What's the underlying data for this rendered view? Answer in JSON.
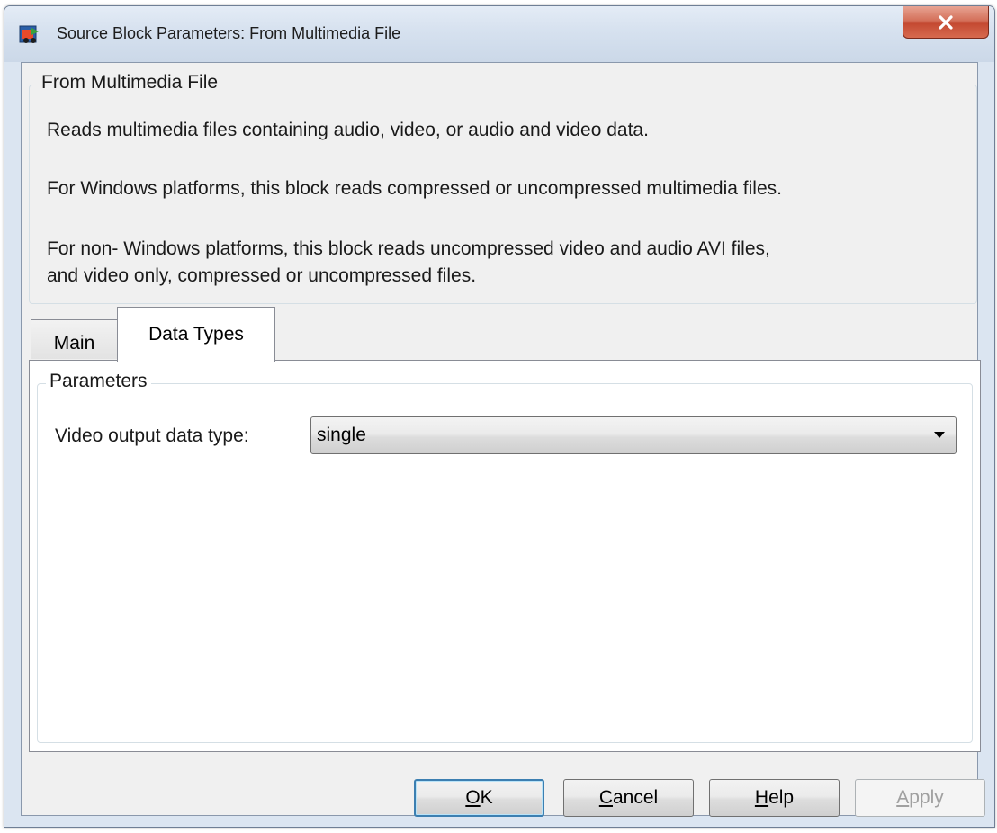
{
  "window": {
    "title": "Source Block Parameters: From Multimedia File",
    "close_label": "x"
  },
  "description": {
    "legend": "From Multimedia File",
    "lines": [
      "Reads multimedia files containing audio, video, or audio and video data.",
      "For Windows platforms, this block reads compressed or uncompressed multimedia files.",
      "For non- Windows platforms, this block reads uncompressed video and audio AVI files,",
      "and video only, compressed or uncompressed files."
    ]
  },
  "tabs": [
    {
      "label": "Main",
      "active": false
    },
    {
      "label": "Data Types",
      "active": true
    }
  ],
  "parameters": {
    "legend": "Parameters",
    "video_output_label": "Video output data type:",
    "video_output_value": "single"
  },
  "buttons": {
    "ok": {
      "mnemonic": "O",
      "rest": "K"
    },
    "cancel": {
      "mnemonic": "C",
      "rest": "ancel"
    },
    "help": {
      "mnemonic": "H",
      "rest": "elp"
    },
    "apply": {
      "mnemonic": "A",
      "rest": "pply",
      "disabled": true
    }
  }
}
